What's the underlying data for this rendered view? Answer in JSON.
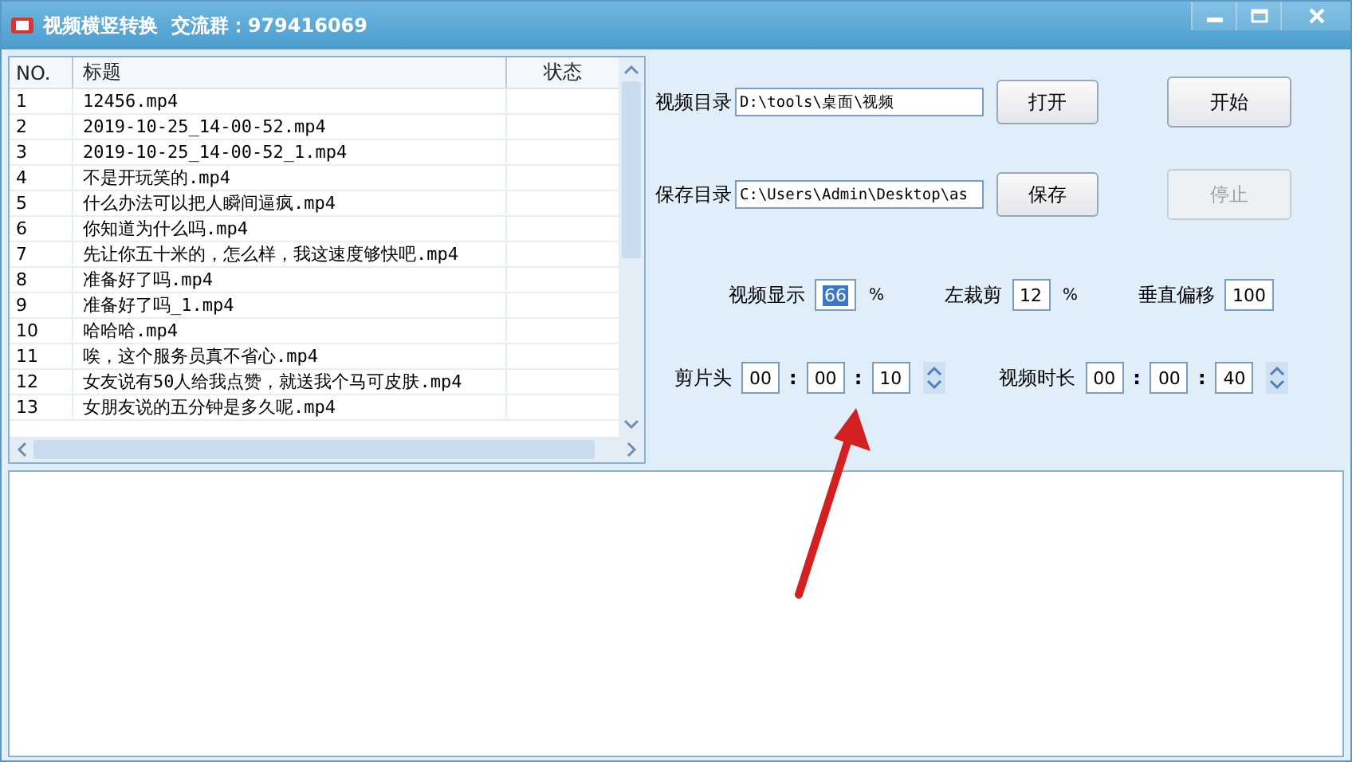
{
  "window": {
    "title": "视频横竖转换  交流群：979416069"
  },
  "file_list": {
    "columns": [
      "NO.",
      "标题",
      "状态"
    ],
    "rows": [
      {
        "no": "1",
        "title": "12456.mp4"
      },
      {
        "no": "2",
        "title": "2019-10-25_14-00-52.mp4"
      },
      {
        "no": "3",
        "title": "2019-10-25_14-00-52_1.mp4"
      },
      {
        "no": "4",
        "title": "不是开玩笑的.mp4"
      },
      {
        "no": "5",
        "title": "什么办法可以把人瞬间逼疯.mp4"
      },
      {
        "no": "6",
        "title": "你知道为什么吗.mp4"
      },
      {
        "no": "7",
        "title": "先让你五十米的，怎么样，我这速度够快吧.mp4"
      },
      {
        "no": "8",
        "title": "准备好了吗.mp4"
      },
      {
        "no": "9",
        "title": "准备好了吗_1.mp4"
      },
      {
        "no": "10",
        "title": "哈哈哈.mp4"
      },
      {
        "no": "11",
        "title": "唉，这个服务员真不省心.mp4"
      },
      {
        "no": "12",
        "title": "女友说有50人给我点赞，就送我个马可皮肤.mp4"
      },
      {
        "no": "13",
        "title": "女朋友说的五分钟是多久呢.mp4"
      }
    ]
  },
  "video_dir": {
    "label": "视频目录",
    "value": "D:\\tools\\桌面\\视频",
    "button": "打开"
  },
  "save_dir": {
    "label": "保存目录",
    "value": "C:\\Users\\Admin\\Desktop\\as",
    "button": "保存"
  },
  "actions": [
    {
      "label": "开始",
      "disabled": false
    },
    {
      "label": "停止",
      "disabled": true
    }
  ],
  "settings": [
    {
      "label": "视频显示",
      "value": "66",
      "unit": "%",
      "highlighted": true
    },
    {
      "label": "左裁剪",
      "value": "12",
      "unit": "%",
      "highlighted": false
    },
    {
      "label": "垂直偏移",
      "value": "100",
      "highlighted": false
    }
  ],
  "times": [
    {
      "label": "剪片头",
      "parts": [
        "00",
        "00",
        "10"
      ],
      "separators": [
        ":",
        ":"
      ]
    },
    {
      "label": "视频时长",
      "parts": [
        "00",
        "00",
        "40"
      ],
      "separators": [
        ":",
        ":"
      ]
    }
  ]
}
